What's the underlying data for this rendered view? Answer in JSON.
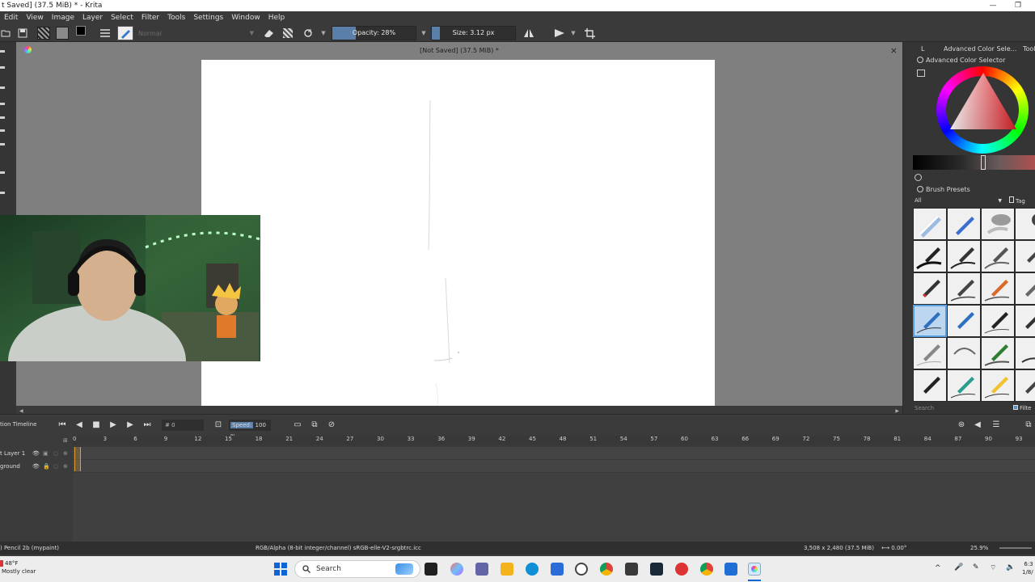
{
  "window": {
    "title": "t Saved]  (37.5 MiB) * - Krita",
    "minimize": "—",
    "maximize": "❐"
  },
  "menu": [
    "Edit",
    "View",
    "Image",
    "Layer",
    "Select",
    "Filter",
    "Tools",
    "Settings",
    "Window",
    "Help"
  ],
  "toolbar": {
    "blend_mode": "Normal",
    "opacity_label": "Opacity: 28%",
    "opacity_value": 28,
    "size_label": "Size: 3.12 px",
    "size_fill_fraction": 0.1
  },
  "canvas": {
    "title": "[Not Saved]  (37.5 MiB) *",
    "close_icon": "×"
  },
  "dock": {
    "tab_left": "L",
    "tab_active": "Advanced Color Sele...",
    "tab_right": "Tool",
    "color_selector_title": "Advanced Color Selector",
    "brush_presets_title": "Brush Presets",
    "filter_all": "All",
    "tag_label": "Tag",
    "search_placeholder": "Search",
    "filter_label": "Filte",
    "accent_color": "#d81f26"
  },
  "timeline": {
    "title": "tion Timeline",
    "frame_label": "# 0",
    "speed_label": "Speed:",
    "speed_value": "100 %",
    "ticks": [
      "0",
      "3",
      "6",
      "9",
      "12",
      "15",
      "18",
      "21",
      "24",
      "27",
      "30",
      "33",
      "36",
      "39",
      "42",
      "45",
      "48",
      "51",
      "54",
      "57",
      "60",
      "63",
      "66",
      "69",
      "72",
      "75",
      "78",
      "81",
      "84",
      "87",
      "90",
      "93"
    ],
    "layers": [
      "t Layer 1",
      "ground"
    ]
  },
  "status": {
    "brush": ") Pencil 2b (mypaint)",
    "color_profile": "RGB/Alpha (8-bit integer/channel)  sRGB-elle-V2-srgbtrc.icc",
    "dimensions": "3,508 x 2,480 (37.5 MiB)",
    "rotation": "0.00°",
    "zoom": "25.9%"
  },
  "taskbar": {
    "weather_temp": "48°F",
    "weather_desc": "Mostly clear",
    "search_label": "Search",
    "clock_time": "6:3",
    "clock_date": "1/8/"
  }
}
